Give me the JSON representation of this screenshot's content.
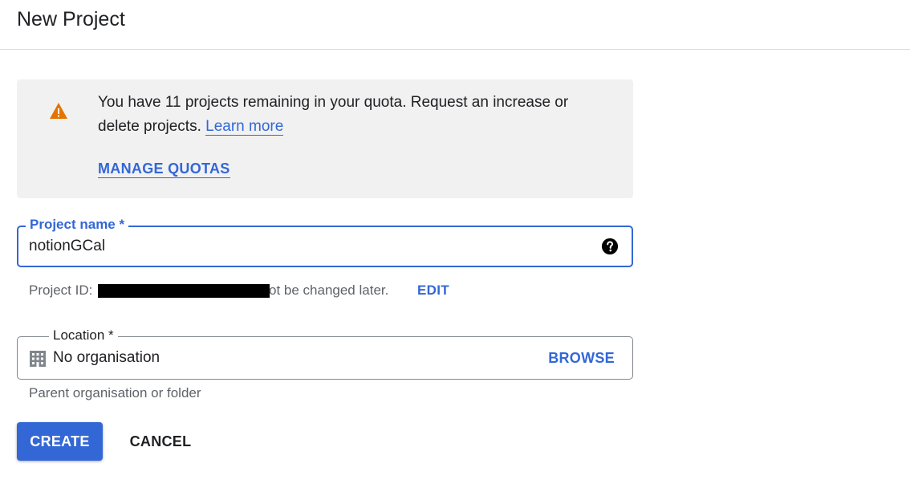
{
  "header": {
    "title": "New Project"
  },
  "notice": {
    "icon": "warning-icon",
    "text": "You have 11 projects remaining in your quota. Request an increase or delete projects.",
    "learn_more": "Learn more",
    "manage_quotas": "MANAGE QUOTAS"
  },
  "project_name": {
    "label": "Project name *",
    "value": "notionGCal",
    "help_icon": "help-icon"
  },
  "project_id": {
    "prefix": "Project ID:",
    "suffix": "ot be changed later.",
    "edit": "EDIT"
  },
  "location": {
    "label": "Location *",
    "icon": "building-icon",
    "value": "No organisation",
    "browse": "BROWSE",
    "hint": "Parent organisation or folder"
  },
  "actions": {
    "create": "CREATE",
    "cancel": "CANCEL"
  },
  "colors": {
    "accent": "#3367d6",
    "warning": "#e37400",
    "notice_bg": "#f1f1f1"
  }
}
